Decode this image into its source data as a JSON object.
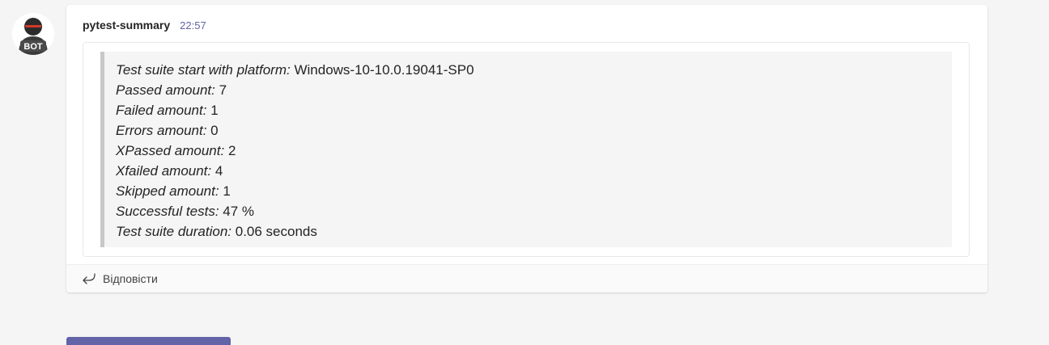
{
  "bot": {
    "avatar_label": "BOT",
    "avatar_icon": "bot-avatar-icon"
  },
  "message": {
    "sender": "pytest-summary",
    "timestamp": "22:57",
    "lines": [
      {
        "label": "Test suite start with platform:",
        "value": "Windows-10-10.0.19041-SP0"
      },
      {
        "label": "Passed amount:",
        "value": "7"
      },
      {
        "label": "Failed amount:",
        "value": "1"
      },
      {
        "label": "Errors amount:",
        "value": "0"
      },
      {
        "label": "XPassed amount:",
        "value": "2"
      },
      {
        "label": "Xfailed amount:",
        "value": "4"
      },
      {
        "label": "Skipped amount:",
        "value": "1"
      },
      {
        "label": "Successful tests:",
        "value": "47 %"
      },
      {
        "label": "Test suite duration:",
        "value": "0.06 seconds"
      }
    ]
  },
  "reply": {
    "label": "Відповісти",
    "icon": "reply-arrow-icon"
  },
  "colors": {
    "accent": "#6264a7",
    "background": "#f5f5f5",
    "quote_bar": "#c8c8c8"
  }
}
